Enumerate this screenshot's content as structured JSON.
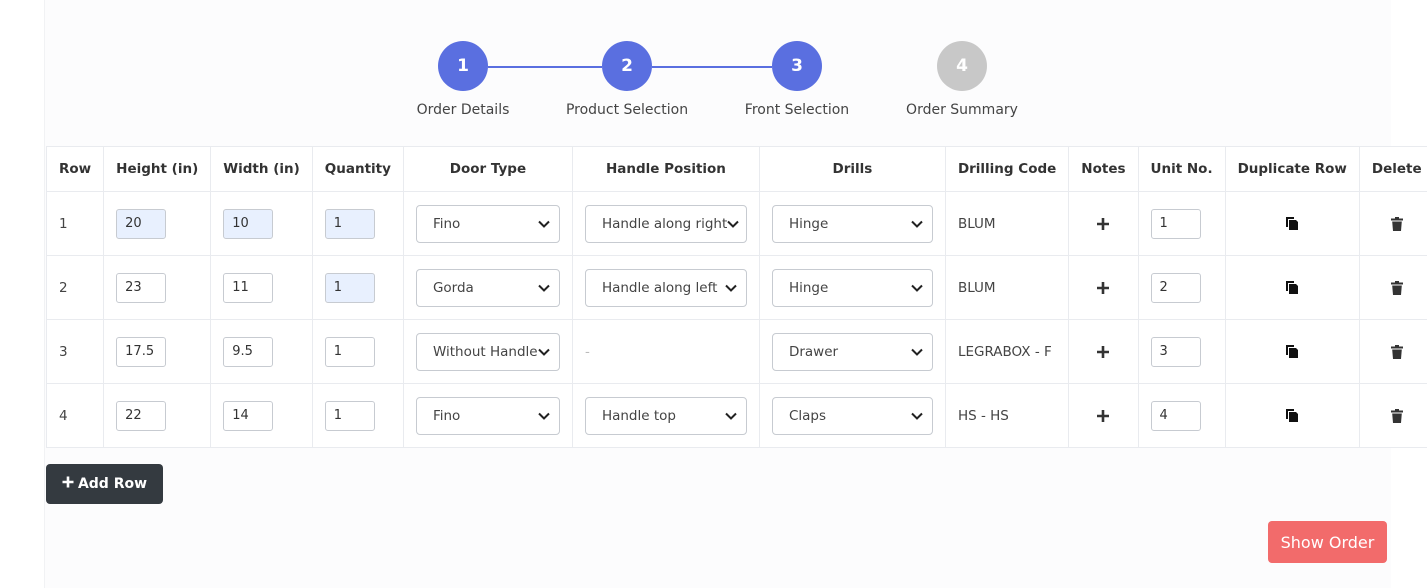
{
  "stepper": {
    "steps": [
      {
        "number": "1",
        "label": "Order Details",
        "state": "completed"
      },
      {
        "number": "2",
        "label": "Product Selection",
        "state": "completed"
      },
      {
        "number": "3",
        "label": "Front Selection",
        "state": "active"
      },
      {
        "number": "4",
        "label": "Order Summary",
        "state": "pending"
      }
    ]
  },
  "table": {
    "headers": {
      "row": "Row",
      "height": "Height (in)",
      "width": "Width (in)",
      "quantity": "Quantity",
      "door_type": "Door Type",
      "handle_position": "Handle Position",
      "drills": "Drills",
      "drilling_code": "Drilling Code",
      "notes": "Notes",
      "unit_no": "Unit No.",
      "duplicate_row": "Duplicate Row",
      "delete": "Delete"
    },
    "rows": [
      {
        "row": "1",
        "height": "20",
        "width": "10",
        "quantity": "1",
        "door_type": "Fino",
        "handle_position": "Handle along right",
        "drills": "Hinge",
        "drilling_code": "BLUM",
        "unit_no": "1"
      },
      {
        "row": "2",
        "height": "23",
        "width": "11",
        "quantity": "1",
        "door_type": "Gorda",
        "handle_position": "Handle along left",
        "drills": "Hinge",
        "drilling_code": "BLUM",
        "unit_no": "2"
      },
      {
        "row": "3",
        "height": "17.5",
        "width": "9.5",
        "quantity": "1",
        "door_type": "Without Handle",
        "handle_position": "-",
        "drills": "Drawer",
        "drilling_code": "LEGRABOX - F",
        "unit_no": "3"
      },
      {
        "row": "4",
        "height": "22",
        "width": "14",
        "quantity": "1",
        "door_type": "Fino",
        "handle_position": "Handle top",
        "drills": "Claps",
        "drilling_code": "HS - HS",
        "unit_no": "4"
      }
    ]
  },
  "actions": {
    "add_row_label": "Add Row",
    "show_order_label": "Show Order"
  },
  "icons": {
    "add": "plus-icon",
    "duplicate": "copy-icon",
    "delete": "trash-icon",
    "dropdown": "chevron-down-icon"
  },
  "colors": {
    "step_active": "#5a6fe0",
    "step_inactive": "#c8c8c8",
    "primary_dark": "#343a40",
    "danger": "#f26b6b",
    "filled_input": "#e8f0fe"
  }
}
